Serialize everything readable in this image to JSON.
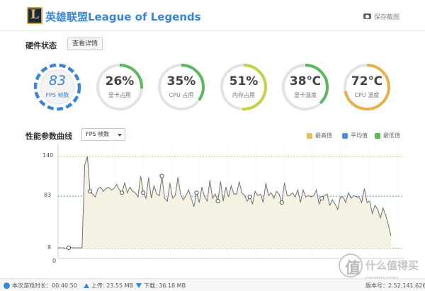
{
  "app": {
    "logo_letter": "L",
    "title": "英雄联盟League of Legends",
    "save_label": "保存截图"
  },
  "hardware": {
    "title": "硬件状态",
    "detail_button": "查看详情",
    "gauges": [
      {
        "value": "83",
        "label": "FPS 帧数",
        "percent": 100,
        "color": "#3a86d6",
        "kind": "fps"
      },
      {
        "value": "26%",
        "label": "显卡占用",
        "percent": 26,
        "color": "#5cb85c",
        "kind": "ring"
      },
      {
        "value": "35%",
        "label": "CPU 占用",
        "percent": 35,
        "color": "#5cb85c",
        "kind": "ring"
      },
      {
        "value": "51%",
        "label": "内存占用",
        "percent": 51,
        "color": "#c8cf4a",
        "kind": "ring"
      },
      {
        "value": "38℃",
        "label": "显卡温度",
        "percent": 38,
        "color": "#5cb85c",
        "kind": "ring"
      },
      {
        "value": "72℃",
        "label": "CPU 温度",
        "percent": 72,
        "color": "#e8b04a",
        "kind": "ring"
      }
    ]
  },
  "performance": {
    "title": "性能参数曲线",
    "select_value": "FPS 帧数",
    "legend": {
      "max_label": "最高值",
      "max_color": "#e2c15a",
      "avg_label": "平均值",
      "avg_color": "#4a90d9",
      "min_label": "最低值",
      "min_color": "#5cb85c"
    }
  },
  "chart_data": {
    "type": "area",
    "ylim": [
      0,
      150
    ],
    "yticks": [
      "140",
      "83",
      "8"
    ],
    "xticks": [
      "0"
    ],
    "max_line": 140,
    "avg_line": 83,
    "min_line": 8,
    "y": [
      9,
      9,
      9,
      8,
      9,
      9,
      9,
      9,
      9,
      9,
      128,
      140,
      90,
      86,
      82,
      94,
      96,
      90,
      94,
      96,
      92,
      94,
      100,
      92,
      88,
      102,
      88,
      96,
      90,
      88,
      82,
      112,
      88,
      80,
      110,
      80,
      98,
      86,
      84,
      112,
      80,
      76,
      102,
      80,
      84,
      110,
      86,
      78,
      84,
      92,
      80,
      68,
      88,
      74,
      96,
      82,
      76,
      106,
      80,
      86,
      76,
      104,
      76,
      96,
      82,
      98,
      86,
      86,
      104,
      88,
      84,
      76,
      82,
      72,
      90,
      84,
      86,
      74,
      102,
      84,
      88,
      80,
      90,
      86,
      74,
      102,
      84,
      84,
      88,
      82,
      92,
      74,
      92,
      82,
      84,
      82,
      84,
      92,
      72,
      80,
      84,
      86,
      70,
      78,
      72,
      64,
      82,
      82,
      74,
      88,
      80,
      84,
      82,
      82,
      74,
      94,
      74,
      76,
      58,
      70,
      64,
      52,
      66,
      56,
      42,
      26
    ],
    "markers": [
      4,
      12,
      24,
      32,
      39,
      52,
      60,
      72,
      84,
      99
    ]
  },
  "footer": {
    "time_label": "本次游戏时长：00:40:50",
    "upload_label": "上传: 23.55 MB",
    "download_label": "下载: 36.18 MB",
    "version_label": "版本号：2.52.141.626"
  },
  "watermark": {
    "icon_char": "值",
    "text": "什么值得买",
    "url": "SMZDM.COM"
  }
}
